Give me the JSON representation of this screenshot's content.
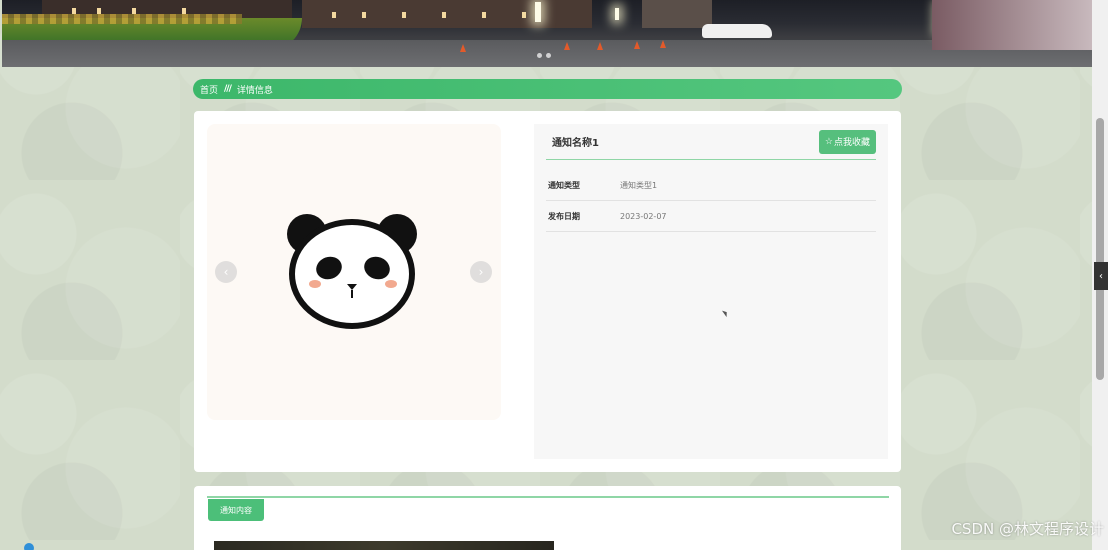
{
  "breadcrumb": {
    "home": "首页",
    "separator": "///",
    "current": "详情信息"
  },
  "detail": {
    "title": "通知名称1",
    "favorite_label": "点我收藏",
    "favorite_icon": "star-outline-icon",
    "fields": [
      {
        "label": "通知类型",
        "value": "通知类型1"
      },
      {
        "label": "发布日期",
        "value": "2023-02-07"
      }
    ]
  },
  "carousel": {
    "prev_icon": "chevron-left-icon",
    "next_icon": "chevron-right-icon"
  },
  "content": {
    "tab_label": "通知内容"
  },
  "side_tab": {
    "icon": "chevron-left-icon"
  },
  "watermark": "CSDN @林文程序设计",
  "colors": {
    "accent": "#4cbf79",
    "background": "#d3dccb"
  }
}
